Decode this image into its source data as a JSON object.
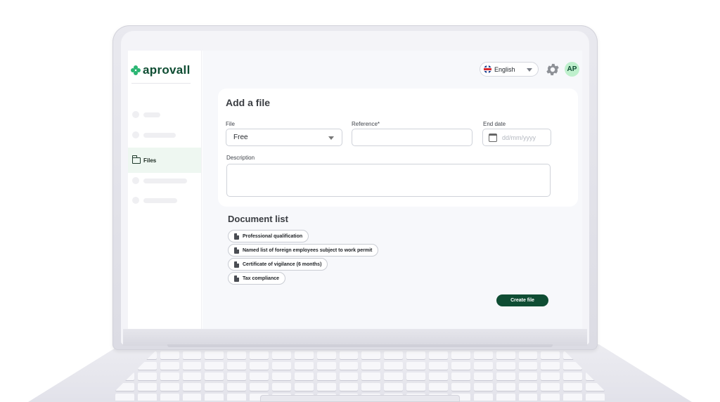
{
  "brand": {
    "name": "aprovall",
    "color": "#0f4d33",
    "accent": "#2bb673"
  },
  "header": {
    "language": "English",
    "language_icon": "uk-flag-icon",
    "settings_icon": "gear-icon",
    "avatar_initials": "AP"
  },
  "sidebar": {
    "items": [
      {
        "label": "",
        "placeholder": true
      },
      {
        "label": "",
        "placeholder": true
      },
      {
        "label": "Files",
        "active": true,
        "icon": "folder-icon"
      },
      {
        "label": "",
        "placeholder": true
      },
      {
        "label": "",
        "placeholder": true
      }
    ]
  },
  "form": {
    "title": "Add a file",
    "file_label": "File",
    "file_value": "Free",
    "reference_label": "Reference*",
    "reference_value": "",
    "end_date_label": "End date",
    "end_date_placeholder": "dd/mm/yyyy",
    "description_label": "Description",
    "description_value": ""
  },
  "documents": {
    "title": "Document list",
    "items": [
      "Professional qualification",
      "Named list of foreign employees subject to work permit",
      "Certificate of vigilance (6 months)",
      "Tax compliance"
    ]
  },
  "actions": {
    "create_label": "Create file"
  }
}
